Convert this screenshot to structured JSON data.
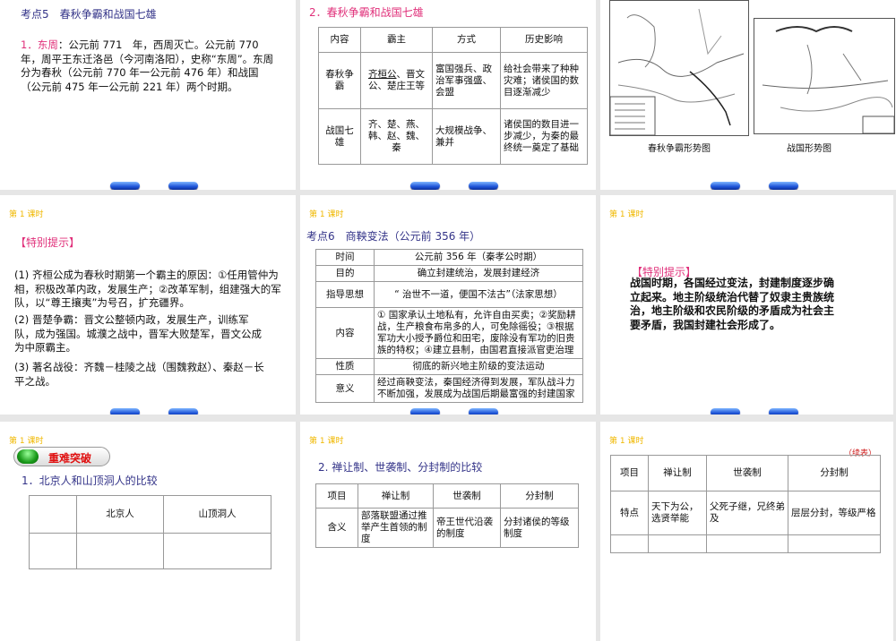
{
  "lesson_label": "第 1 课时",
  "s1": {
    "title": "考点5　春秋争霸和战国七雄",
    "lead": "1．东周",
    "text": "：公元前 771　年，西周灭亡。公元前 770 年，周平王东迁洛邑（今河南洛阳），史称“东周”。东周分为春秋（公元前 770 年一公元前 476 年）和战国（公元前 475 年一公元前 221 年）两个时期。"
  },
  "s2": {
    "title": "2．春秋争霸和战国七雄",
    "headers": [
      "内容",
      "霸主",
      "方式",
      "历史影响"
    ],
    "rows": [
      {
        "a": "春秋争霸",
        "b_u": "齐桓公",
        "b": "、晋文公、楚庄王等",
        "c": "富国强兵、政治军事强盛、会盟",
        "d": "给社会带来了种种灾难；诸侯国的数目逐渐减少"
      },
      {
        "a": "战国七雄",
        "b_u": "",
        "b": "齐、楚、燕、韩、赵、魏、秦",
        "c": "大规模战争、兼并",
        "d": "诸侯国的数目进一步减少，为秦的最终统一奠定了基础"
      }
    ]
  },
  "s3": {
    "caption_left": "春秋争霸形势图",
    "caption_right": "战国形势图"
  },
  "s4": {
    "tip": "【特别提示】",
    "p1": "(1) 齐桓公成为春秋时期第一个霸主的原因：①任用管仲为相，积极改革内政，发展生产；②改革军制，组建强大的军队，以“尊王攘夷”为号召，扩充疆界。",
    "p2": "(2) 晋楚争霸：晋文公整顿内政，发展生产，训练军队，成为强国。城濮之战中，晋军大败楚军，晋文公成为中原霸主。",
    "p3": "(3) 著名战役：齐魏－桂陵之战（围魏救赵）、秦赵－长平之战。"
  },
  "s5": {
    "title": "考点6　商鞅变法（公元前 356 年）",
    "rows": [
      {
        "k": "时间",
        "v": "公元前 356 年（秦孝公时期）"
      },
      {
        "k": "目的",
        "v": "确立封建统治，发展封建经济"
      },
      {
        "k": "指导思想",
        "v": "“ 治世不一道，便国不法古”（法家思想）"
      },
      {
        "k": "内容",
        "v": "① 国家承认土地私有，允许自由买卖；②奖励耕战，生产粮食布帛多的人，可免除徭役；③根据军功大小授予爵位和田宅，废除没有军功的旧贵族的特权；④建立县制，由国君直接派官吏治理"
      },
      {
        "k": "性质",
        "v": "彻底的新兴地主阶级的变法运动"
      },
      {
        "k": "意义",
        "v": "经过商鞅变法，秦国经济得到发展，军队战斗力不断加强，发展成为战国后期最富强的封建国家"
      }
    ]
  },
  "s6": {
    "tip": "【特别提示】",
    "text": "战国时期，各国经过变法，封建制度逐步确立起来。地主阶级统治代替了奴隶主贵族统治，地主阶级和农民阶级的矛盾成为社会主要矛盾，我国封建社会形成了。"
  },
  "s7": {
    "badge": "重难突破",
    "title": "1．北京人和山顶洞人的比较",
    "headers": [
      "",
      "北京人",
      "山顶洞人"
    ]
  },
  "s8": {
    "title": "2. 禅让制、世袭制、分封制的比较",
    "headers": [
      "项目",
      "禅让制",
      "世袭制",
      "分封制"
    ],
    "row": [
      "含义",
      "部落联盟通过推举产生首领的制度",
      "帝王世代沿袭的制度",
      "分封诸侯的等级制度"
    ]
  },
  "s9": {
    "cont": "（续表）",
    "headers": [
      "项目",
      "禅让制",
      "世袭制",
      "分封制"
    ],
    "row": [
      "特点",
      "天下为公，选贤举能",
      "父死子继，兄终弟及",
      "层层分封，等级严格"
    ]
  }
}
